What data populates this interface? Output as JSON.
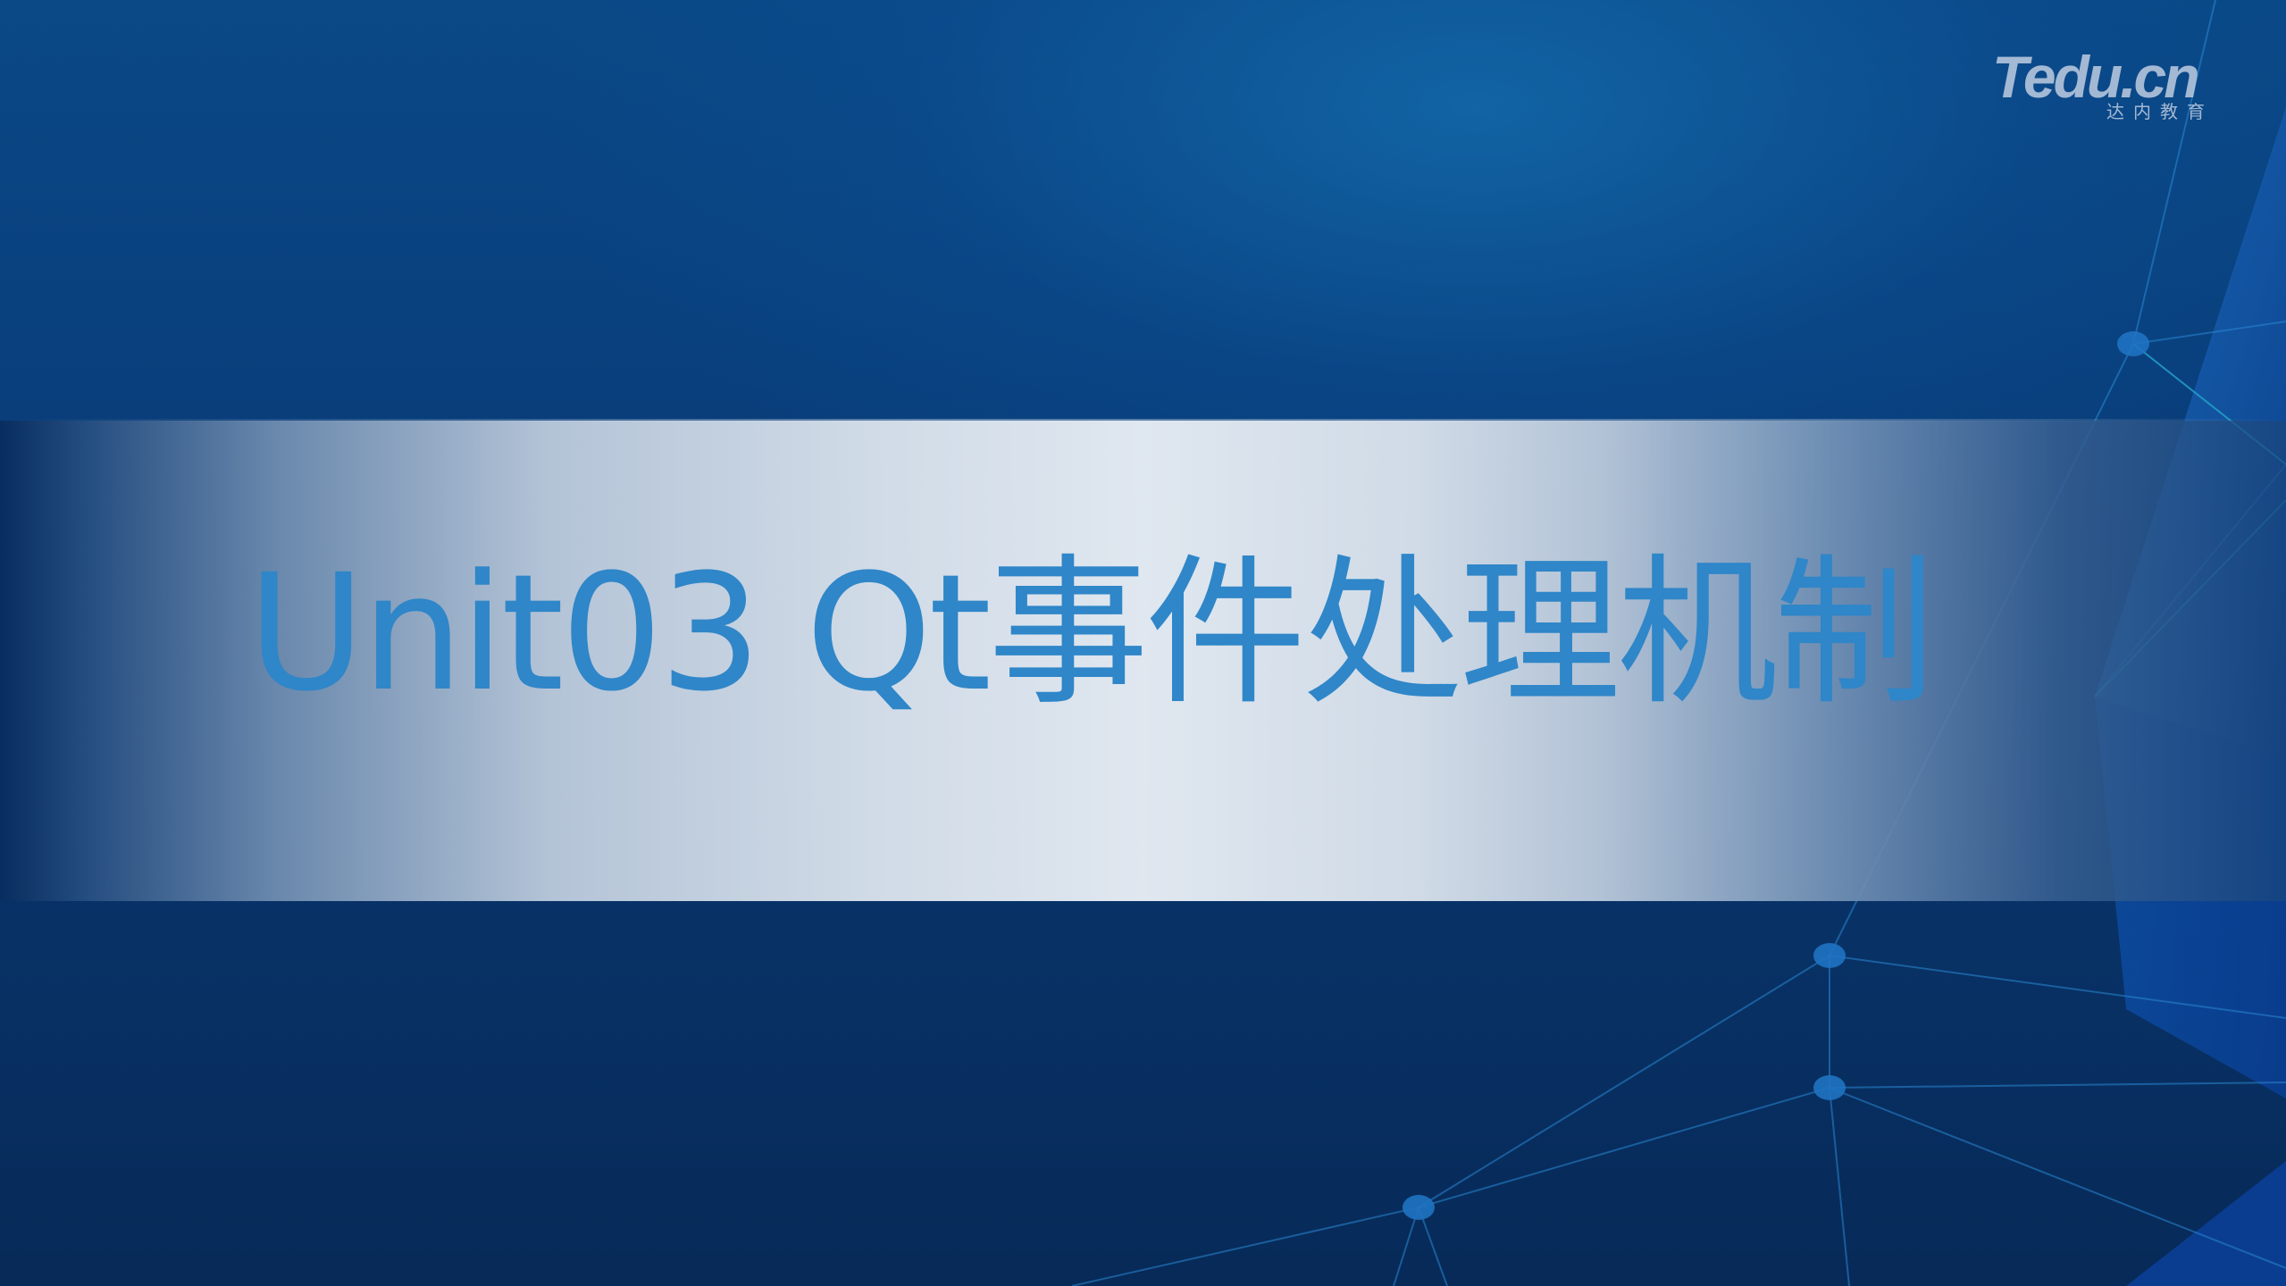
{
  "slide": {
    "title": "Unit03 Qt事件处理机制"
  },
  "logo": {
    "brand": "Tedu.cn",
    "subtitle": "达内教育"
  },
  "colors": {
    "background_top": "#0a4886",
    "background_bottom": "#072a58",
    "band_center": "#e2e9f1",
    "title": "#2f86c8",
    "network_lines": "#1e78c8"
  }
}
